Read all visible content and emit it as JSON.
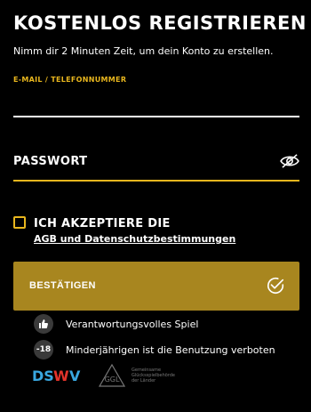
{
  "header": {
    "title": "KOSTENLOS REGISTRIEREN",
    "subtitle": "Nimm dir 2 Minuten Zeit, um dein Konto zu erstellen."
  },
  "form": {
    "email_label": "E-MAIL / TELEFONNUMMER",
    "email_value": "",
    "password_label": "PASSWORT",
    "terms_line1": "ICH AKZEPTIERE DIE",
    "terms_link": "AGB und Datenschutzbestimmungen",
    "terms_checked": false,
    "confirm_label": "BESTÄTIGEN"
  },
  "info": [
    {
      "icon": "thumbs-up-icon",
      "text": "Verantwortungsvolles Spiel"
    },
    {
      "icon": "age-restriction-icon",
      "badge": "-18",
      "text": "Minderjährigen ist die Benutzung verboten"
    }
  ],
  "footer": {
    "logos": [
      "DSWV",
      "GGL"
    ],
    "ggl_caption": "Gemeinsame Glücksspielbehörde der Länder"
  },
  "colors": {
    "accent": "#e8b61e",
    "button": "#a8861f",
    "background": "#000000"
  }
}
